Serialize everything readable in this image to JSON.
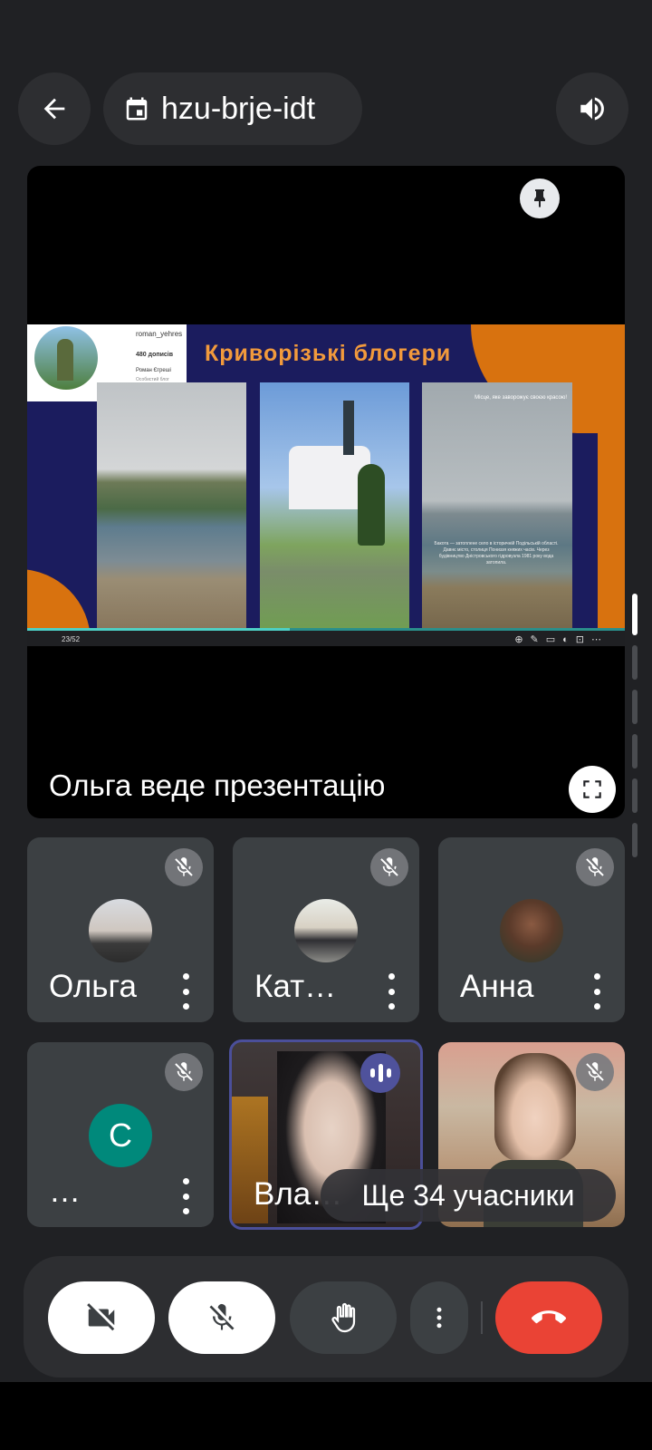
{
  "header": {
    "meeting_code": "hzu-brje-idt",
    "icons": {
      "back": "arrow-back-icon",
      "calendar": "calendar-icon",
      "audio": "volume-icon"
    }
  },
  "presentation": {
    "presenter_label": "Ольга веде презентацію",
    "slide": {
      "title": "Криворізькі блогери",
      "profile_username": "roman_yehres",
      "profile_posts": "480 дописів",
      "profile_name": "Роман Єгреші",
      "profile_sub": "Особистий блог",
      "photo3_header": "Місце, яке заворожує своєю красою!",
      "photo3_caption": "Бакота — затоплене село в історичній Подільській області. Давнє місто, столиця Пониззя княжих часів. Через будівництво Дністровського гідровузла 1981 року вода затопила.",
      "page_indicator": "23/52"
    },
    "icons": {
      "pin": "pin-icon",
      "fullscreen": "fullscreen-icon"
    }
  },
  "participants": [
    {
      "name": "Ольга",
      "muted": true
    },
    {
      "name": "Кат…",
      "muted": true
    },
    {
      "name": "Анна",
      "muted": true
    },
    {
      "name": "…",
      "initial": "C",
      "avatar_color": "#00897b",
      "muted": true
    },
    {
      "name": "Вла…",
      "speaking": true
    },
    {
      "name": "",
      "muted": true
    }
  ],
  "more_participants": "Ще 34 учасники",
  "controls": {
    "icons": [
      "camera-off-icon",
      "mic-off-icon",
      "raise-hand-icon",
      "more-vert-icon",
      "call-end-icon"
    ],
    "end_color": "#ea4335"
  },
  "colors": {
    "background": "#202124",
    "tile": "#3c4043",
    "accent": "#4f529c"
  }
}
